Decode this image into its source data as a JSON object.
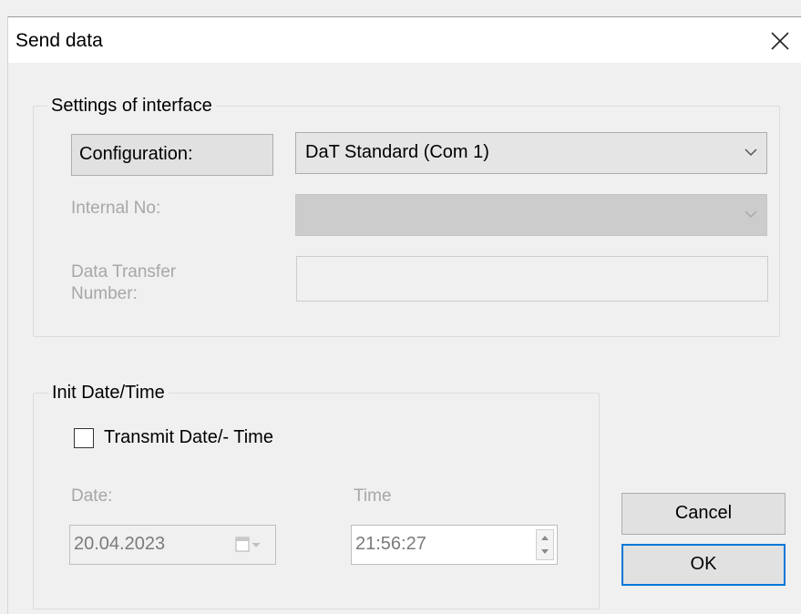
{
  "window": {
    "title": "Send data",
    "close_icon": "close-icon"
  },
  "interface_group": {
    "label": "Settings of interface",
    "configuration_label": "Configuration:",
    "configuration_value": "DaT Standard (Com 1)",
    "internal_no_label": "Internal No:",
    "internal_no_value": "",
    "transfer_number_label_line1": "Data Transfer",
    "transfer_number_label_line2": "Number:",
    "transfer_number_value": ""
  },
  "datetime_group": {
    "label": "Init Date/Time",
    "transmit_checkbox_label": "Transmit Date/- Time",
    "transmit_checked": false,
    "date_label": "Date:",
    "date_value": "20.04.2023",
    "time_label": "Time",
    "time_value": "21:56:27"
  },
  "buttons": {
    "cancel": "Cancel",
    "ok": "OK"
  },
  "colors": {
    "focus_border": "#0078d7",
    "disabled_text": "#a7a7a7"
  }
}
